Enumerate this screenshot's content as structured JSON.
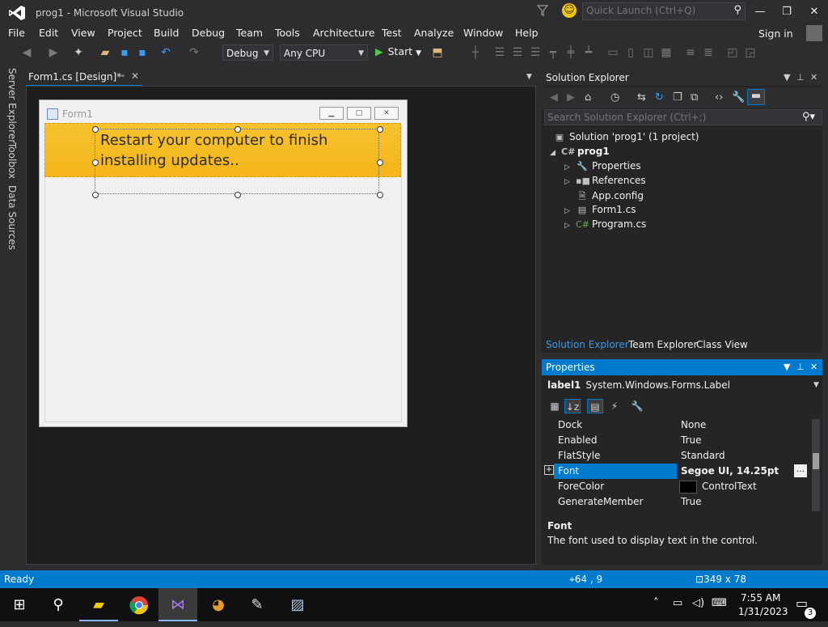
{
  "window": {
    "title": "prog1 - Microsoft Visual Studio",
    "quick_launch_placeholder": "Quick Launch (Ctrl+Q)",
    "controls": [
      "minimize",
      "maximize",
      "close"
    ]
  },
  "menu": {
    "items": [
      "File",
      "Edit",
      "View",
      "Project",
      "Build",
      "Debug",
      "Team",
      "Tools",
      "Architecture",
      "Test",
      "Analyze",
      "Window",
      "Help"
    ],
    "signin": "Sign in"
  },
  "toolbar": {
    "config": "Debug",
    "platform": "Any CPU",
    "start": "Start"
  },
  "left_tabs": [
    "Server Explorer",
    "Toolbox",
    "Data Sources"
  ],
  "document_tab": {
    "label": "Form1.cs [Design]*"
  },
  "form": {
    "title": "Form1",
    "label_text": "Restart your computer to finish installing updates..",
    "banner_color": "#f3b51a"
  },
  "solution_explorer": {
    "title": "Solution Explorer",
    "search_placeholder": "Search Solution Explorer (Ctrl+;)",
    "tree": [
      {
        "label": "Solution 'prog1' (1 project)",
        "icon": "solution-icon"
      },
      {
        "label": "prog1",
        "icon": "csharp-project-icon"
      },
      {
        "label": "Properties",
        "icon": "wrench-icon"
      },
      {
        "label": "References",
        "icon": "references-icon"
      },
      {
        "label": "App.config",
        "icon": "config-file-icon"
      },
      {
        "label": "Form1.cs",
        "icon": "form-file-icon"
      },
      {
        "label": "Program.cs",
        "icon": "csharp-file-icon"
      }
    ],
    "bottom_tabs": [
      "Solution Explorer",
      "Team Explorer",
      "Class View"
    ]
  },
  "properties": {
    "title": "Properties",
    "object_name": "label1",
    "object_type": "System.Windows.Forms.Label",
    "rows": [
      {
        "name": "Dock",
        "value": "None"
      },
      {
        "name": "Enabled",
        "value": "True"
      },
      {
        "name": "FlatStyle",
        "value": "Standard"
      },
      {
        "name": "Font",
        "value": "Segoe UI, 14.25pt"
      },
      {
        "name": "ForeColor",
        "value": "ControlText"
      },
      {
        "name": "GenerateMember",
        "value": "True"
      }
    ],
    "selected": "Font",
    "desc_title": "Font",
    "desc_text": "The font used to display text in the control."
  },
  "status": {
    "state": "Ready",
    "position": "64 , 9",
    "size": "349 x 78"
  },
  "taskbar": {
    "time": "7:55 AM",
    "date": "1/31/2023",
    "notifications": "3",
    "apps": [
      "file-explorer-icon",
      "chrome-icon",
      "visual-studio-icon",
      "app-swirl-icon",
      "paint-icon",
      "app-window-icon"
    ]
  }
}
